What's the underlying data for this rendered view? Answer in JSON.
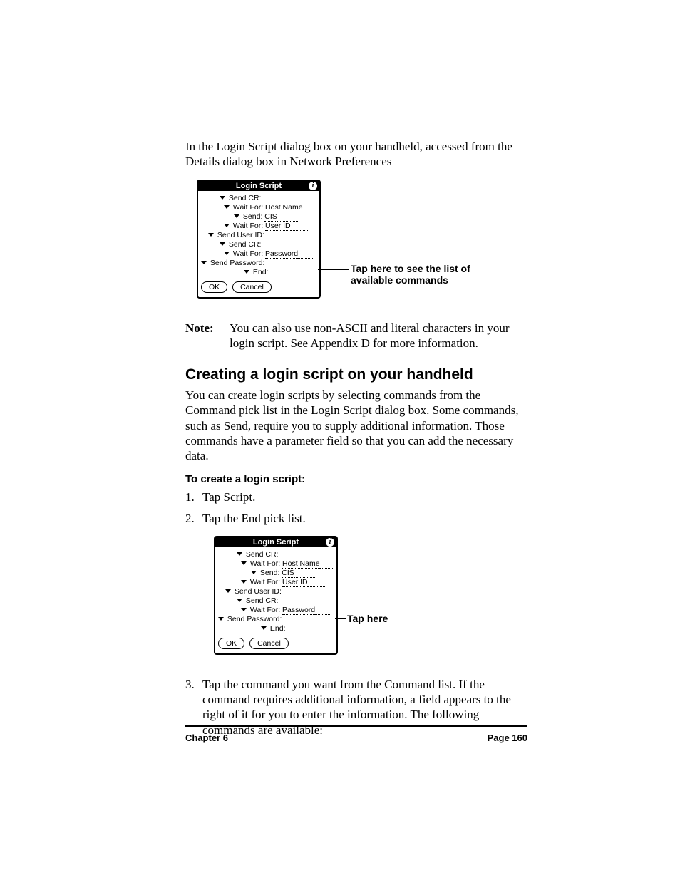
{
  "intro": "In the Login Script dialog box on your handheld, accessed from the Details dialog box in Network Preferences",
  "dialog": {
    "title": "Login Script",
    "lines": [
      {
        "indent": 26,
        "label": "Send CR:"
      },
      {
        "indent": 32,
        "label": "Wait For:",
        "value": "Host Name"
      },
      {
        "indent": 46,
        "label": "Send:",
        "value": "CIS"
      },
      {
        "indent": 32,
        "label": "Wait For:",
        "value": "User ID"
      },
      {
        "indent": 10,
        "label": "Send User ID:"
      },
      {
        "indent": 26,
        "label": "Send CR:"
      },
      {
        "indent": 32,
        "label": "Wait For:",
        "value": "Password"
      },
      {
        "indent": 0,
        "label": "Send Password:"
      },
      {
        "indent": 60,
        "label": "End:"
      }
    ],
    "ok": "OK",
    "cancel": "Cancel"
  },
  "callout1": "Tap here to see the list of available commands",
  "callout2": "Tap here",
  "note_label": "Note:",
  "note_body": "You can also use non-ASCII and literal characters in your login script. See Appendix D for more information.",
  "heading": "Creating a login script on your handheld",
  "heading_para": "You can create login scripts by selecting commands from the Command pick list in the Login Script dialog box. Some commands, such as Send, require you to supply additional information. Those commands have a parameter field so that you can add the necessary data.",
  "subhead": "To create a login script:",
  "step1_num": "1.",
  "step1": "Tap Script.",
  "step2_num": "2.",
  "step2": "Tap the End pick list.",
  "step3_num": "3.",
  "step3": "Tap the command you want from the Command list. If the command requires additional information, a field appears to the right of it for you to enter the information. The following commands are available:",
  "footer_left": "Chapter 6",
  "footer_right": "Page 160"
}
